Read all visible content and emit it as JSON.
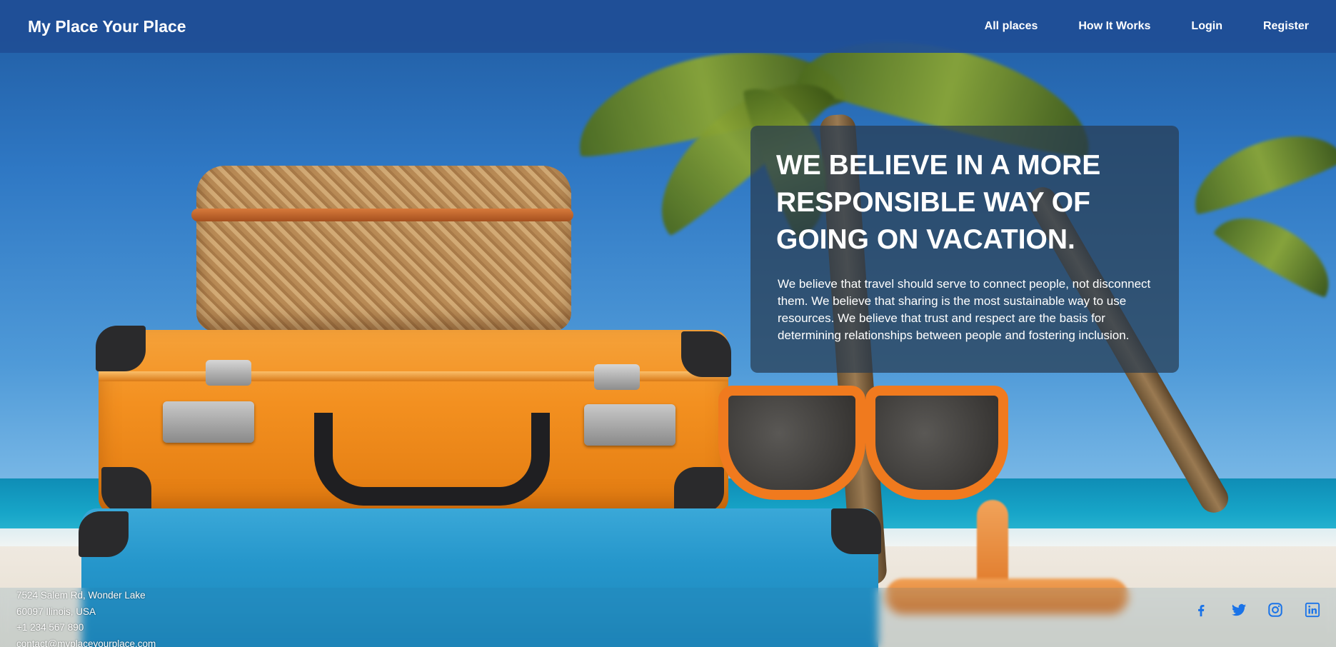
{
  "header": {
    "brand": "My Place Your Place",
    "nav": [
      "All places",
      "How It Works",
      "Login",
      "Register"
    ]
  },
  "hero": {
    "title": "WE BELIEVE IN A MORE RESPONSIBLE WAY OF GOING ON VACATION.",
    "body": "We believe that travel should serve to connect people, not disconnect them. We believe that sharing is the most sustainable way to use resources. We believe that trust and respect are the basis for determining relationships between people and fostering inclusion."
  },
  "footer": {
    "address_line1": "7524 Salem Rd, Wonder Lake",
    "address_line2": "60097 Ilinois, USA",
    "phone": "+1 234 567 890",
    "email": "contact@myplaceyourplace.com",
    "socials": [
      "facebook-icon",
      "twitter-icon",
      "instagram-icon",
      "linkedin-icon"
    ],
    "social_color": "#1a73e8"
  },
  "colors": {
    "header_bg": "#1f4e96",
    "card_bg": "#283c50"
  }
}
